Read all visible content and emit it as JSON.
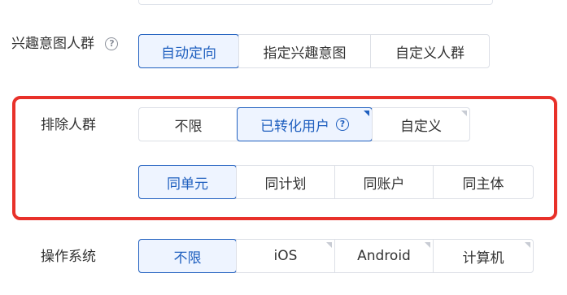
{
  "interest_audience": {
    "label": "兴趣意图人群",
    "help_glyph": "?",
    "options": [
      "自动定向",
      "指定兴趣意图",
      "自定义人群"
    ],
    "selected": "自动定向"
  },
  "exclude_audience": {
    "label": "排除人群",
    "help_glyph": "?",
    "options": [
      "不限",
      "已转化用户",
      "自定义"
    ],
    "selected": "已转化用户",
    "scope_options": [
      "同单元",
      "同计划",
      "同账户",
      "同主体"
    ],
    "scope_selected": "同单元"
  },
  "operating_system": {
    "label": "操作系统",
    "options": [
      "不限",
      "iOS",
      "Android",
      "计算机"
    ],
    "selected": "不限"
  },
  "colors": {
    "accent": "#1f5fbf",
    "selected_bg": "#eef4ff",
    "highlight_border": "#e8312a",
    "border": "#dcdfe6"
  },
  "icons": {
    "help": "question-circle-icon",
    "corner": "corner-triangle-icon"
  }
}
